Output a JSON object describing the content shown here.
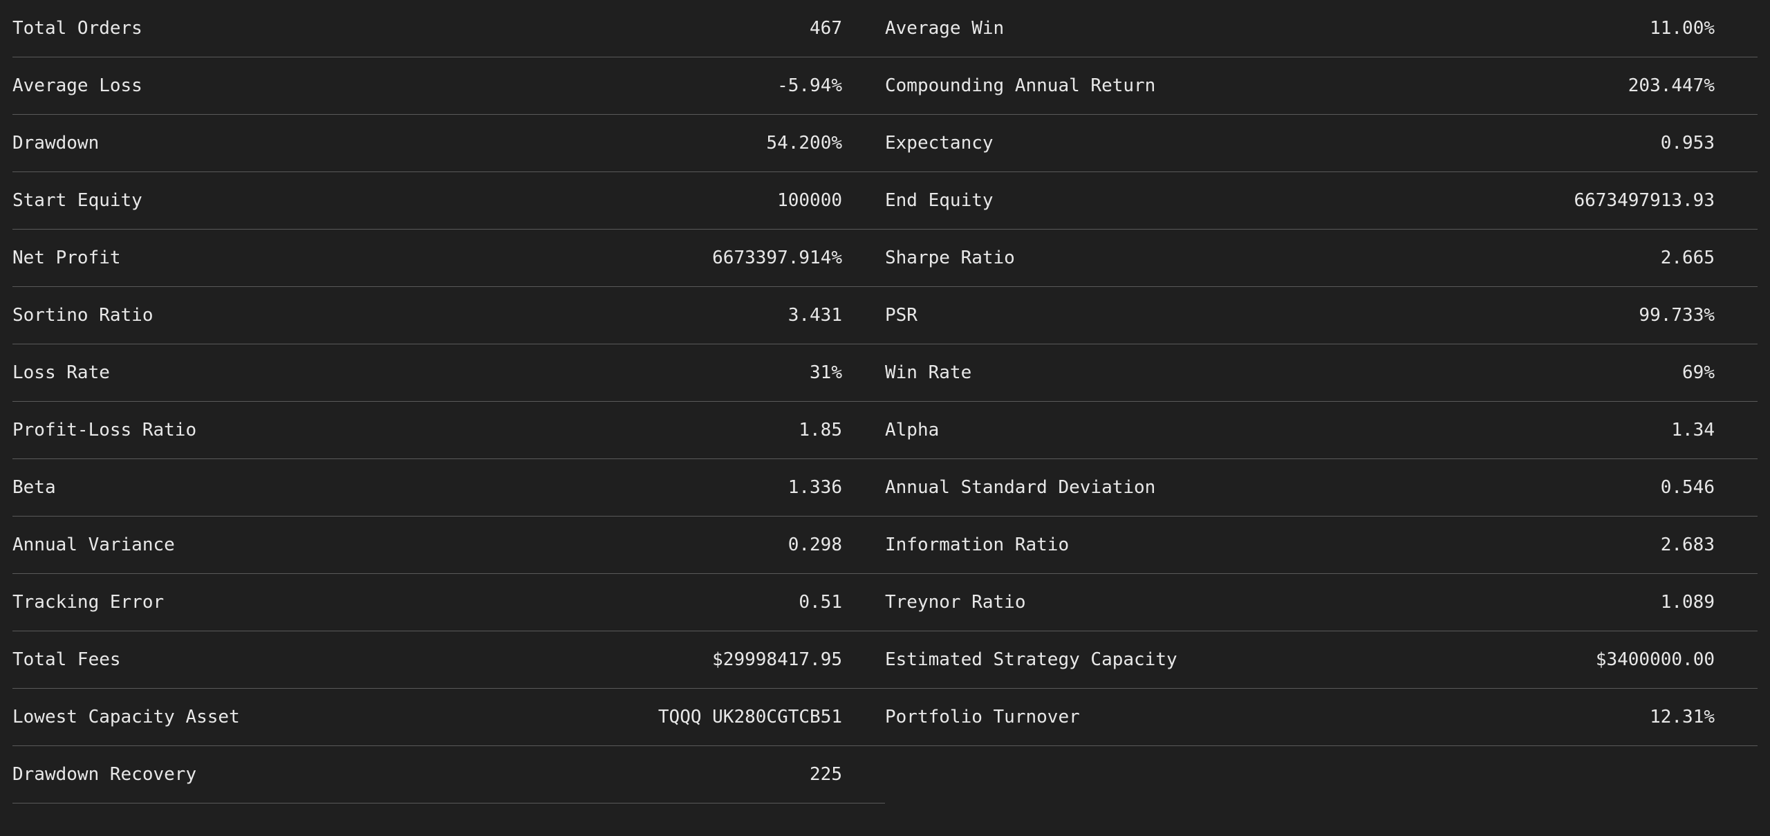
{
  "stats": {
    "left": [
      {
        "label": "Total Orders",
        "value": "467"
      },
      {
        "label": "Average Loss",
        "value": "-5.94%"
      },
      {
        "label": "Drawdown",
        "value": "54.200%"
      },
      {
        "label": "Start Equity",
        "value": "100000"
      },
      {
        "label": "Net Profit",
        "value": "6673397.914%"
      },
      {
        "label": "Sortino Ratio",
        "value": "3.431"
      },
      {
        "label": "Loss Rate",
        "value": "31%"
      },
      {
        "label": "Profit-Loss Ratio",
        "value": "1.85"
      },
      {
        "label": "Beta",
        "value": "1.336"
      },
      {
        "label": "Annual Variance",
        "value": "0.298"
      },
      {
        "label": "Tracking Error",
        "value": "0.51"
      },
      {
        "label": "Total Fees",
        "value": "$29998417.95"
      },
      {
        "label": "Lowest Capacity Asset",
        "value": "TQQQ UK280CGTCB51"
      },
      {
        "label": "Drawdown Recovery",
        "value": "225"
      }
    ],
    "right": [
      {
        "label": "Average Win",
        "value": "11.00%"
      },
      {
        "label": "Compounding Annual Return",
        "value": "203.447%"
      },
      {
        "label": "Expectancy",
        "value": "0.953"
      },
      {
        "label": "End Equity",
        "value": "6673497913.93"
      },
      {
        "label": "Sharpe Ratio",
        "value": "2.665"
      },
      {
        "label": "PSR",
        "value": "99.733%"
      },
      {
        "label": "Win Rate",
        "value": "69%"
      },
      {
        "label": "Alpha",
        "value": "1.34"
      },
      {
        "label": "Annual Standard Deviation",
        "value": "0.546"
      },
      {
        "label": "Information Ratio",
        "value": "2.683"
      },
      {
        "label": "Treynor Ratio",
        "value": "1.089"
      },
      {
        "label": "Estimated Strategy Capacity",
        "value": "$3400000.00"
      },
      {
        "label": "Portfolio Turnover",
        "value": "12.31%"
      }
    ]
  },
  "colors": {
    "background": "#1f1f1f",
    "text": "#e8e8e8",
    "divider": "#5a5a5a"
  }
}
